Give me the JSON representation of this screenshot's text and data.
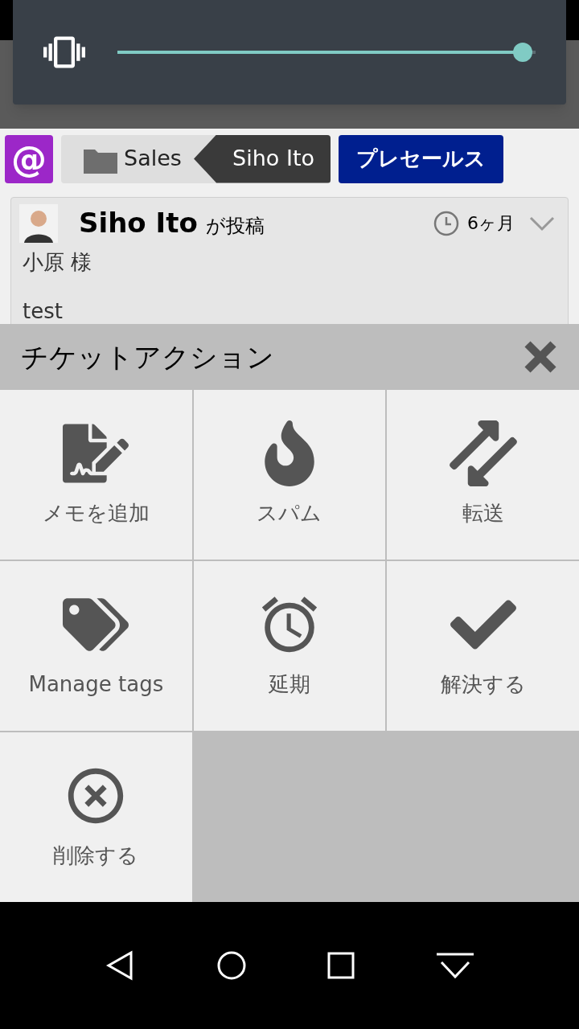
{
  "volume": {
    "level": 0.97
  },
  "breadcrumb": {
    "mention": "@",
    "folder": "Sales",
    "assignee": "Siho Ito",
    "tag": "プレセールス"
  },
  "post": {
    "author": "Siho Ito",
    "verb": "が投稿",
    "time": "6ヶ月",
    "lines": [
      "小原 様",
      "test"
    ]
  },
  "sheet": {
    "title": "チケットアクション",
    "actions": [
      {
        "label": "メモを追加",
        "kind": "note"
      },
      {
        "label": "スパム",
        "kind": "spam"
      },
      {
        "label": "転送",
        "kind": "forward"
      },
      {
        "label": "Manage tags",
        "kind": "tags"
      },
      {
        "label": "延期",
        "kind": "snooze"
      },
      {
        "label": "解決する",
        "kind": "resolve"
      },
      {
        "label": "削除する",
        "kind": "delete"
      }
    ]
  }
}
